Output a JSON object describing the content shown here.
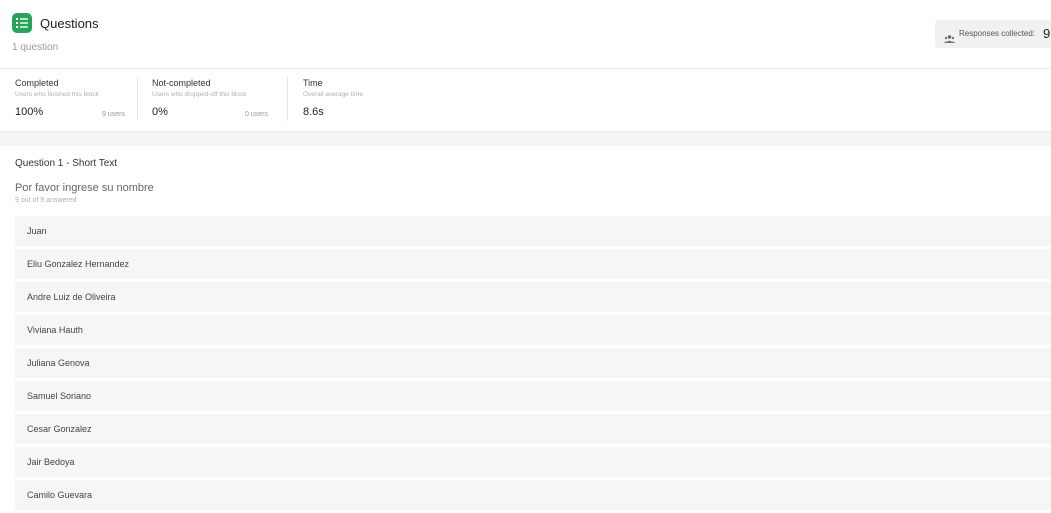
{
  "header": {
    "title": "Questions",
    "subtitle": "1 question",
    "icon": "list-icon",
    "accent": "#27a35a",
    "responses_label": "Responses collected:",
    "responses_value": "9"
  },
  "stats": [
    {
      "label": "Completed",
      "desc": "Users who finished this block",
      "value": "100%",
      "users": "9 users"
    },
    {
      "label": "Not-completed",
      "desc": "Users who dropped-off this block",
      "value": "0%",
      "users": "0 users"
    },
    {
      "label": "Time",
      "desc": "Overall average time",
      "value": "8.6s"
    }
  ],
  "question": {
    "title": "Question 1 - Short Text",
    "text": "Por favor ingrese su nombre",
    "answered": "9 out of 9 answered",
    "answers": [
      "Juan",
      "Eliu Gonzalez Hernandez",
      "Andre Luiz de Oliveira",
      "Viviana Hauth",
      "Juliana Genova",
      "Samuel Soriano",
      "Cesar Gonzalez",
      "Jair Bedoya",
      "Camilo Guevara"
    ]
  }
}
